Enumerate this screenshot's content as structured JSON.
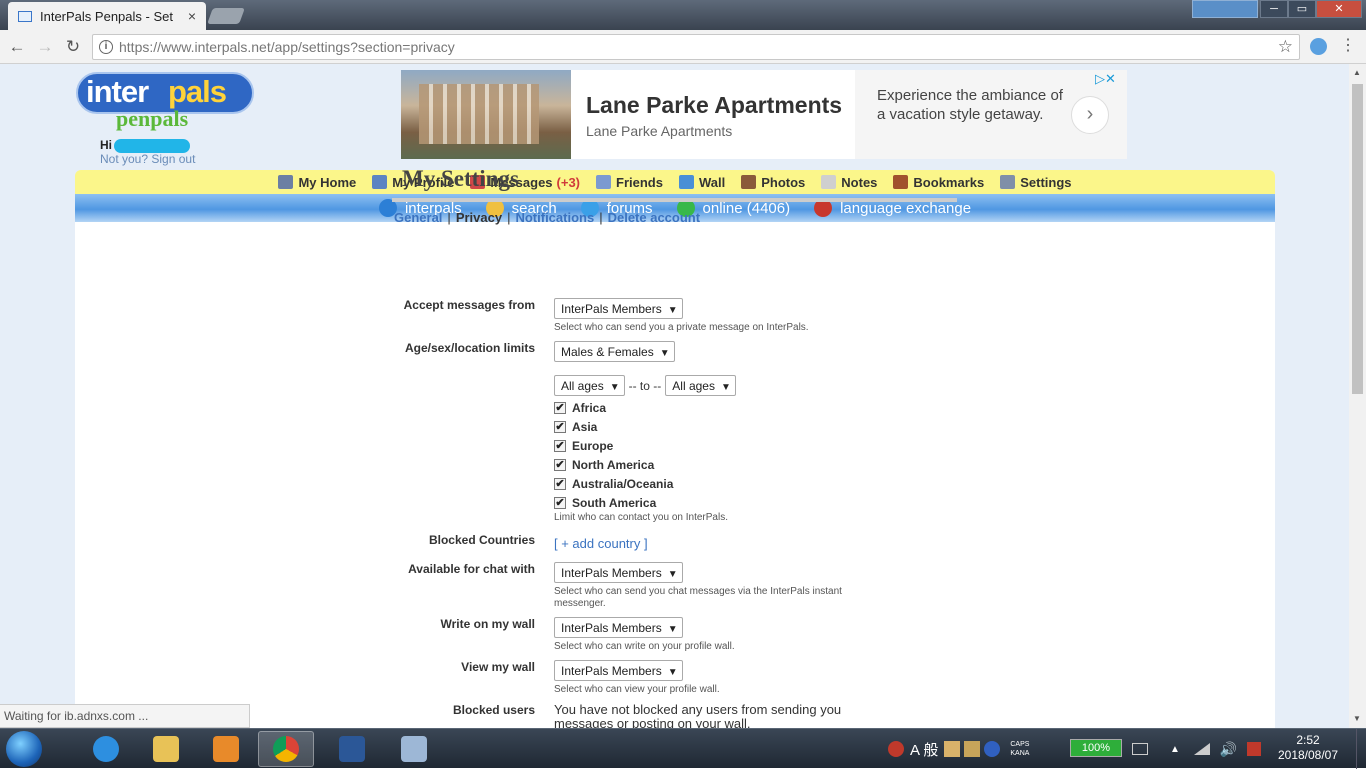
{
  "browser": {
    "tab_title": "InterPals Penpals - Set",
    "tab_close": "×",
    "url_host": "https://www.interpals.net",
    "url_path": "/app/settings?section=privacy",
    "back": "←",
    "forward": "→",
    "reload": "↻",
    "info": "i",
    "star": "☆",
    "menu": "⋮",
    "minimize": "─",
    "maximize": "▭",
    "close": "✕"
  },
  "header": {
    "logo_inter": "inter",
    "logo_pals": "pals",
    "logo_penpals": "penpals",
    "greeting": "Hi",
    "signout": "Not you? Sign out"
  },
  "ad": {
    "title": "Lane Parke Apartments",
    "subtitle": "Lane Parke Apartments",
    "copy": "Experience the ambiance of a vacation style getaway.",
    "next": "›",
    "adchoices": "▷✕"
  },
  "main_nav": [
    {
      "label": "My Home",
      "icon": "home-icon",
      "color": "#6b7fa3"
    },
    {
      "label": "My Profile",
      "icon": "profile-icon",
      "color": "#5c84c2"
    },
    {
      "label": "Messages",
      "icon": "envelope-icon",
      "color": "#d04848",
      "count": "(+3)"
    },
    {
      "label": "Friends",
      "icon": "friends-icon",
      "color": "#7b9ad0"
    },
    {
      "label": "Wall",
      "icon": "wall-icon",
      "color": "#4a8fd6"
    },
    {
      "label": "Photos",
      "icon": "photos-icon",
      "color": "#8a5a3a"
    },
    {
      "label": "Notes",
      "icon": "notes-icon",
      "color": "#cfcfcf"
    },
    {
      "label": "Bookmarks",
      "icon": "bookmark-icon",
      "color": "#a0522d"
    },
    {
      "label": "Settings",
      "icon": "settings-icon",
      "color": "#7f8fa8"
    }
  ],
  "sub_nav": [
    {
      "label": "interpals",
      "icon": "globe-icon",
      "color": "#2c7fd6"
    },
    {
      "label": "search",
      "icon": "search-icon",
      "color": "#f0c040"
    },
    {
      "label": "forums",
      "icon": "forums-icon",
      "color": "#3aa0e8"
    },
    {
      "label": "online (4406)",
      "icon": "online-icon",
      "color": "#38b84a"
    },
    {
      "label": "language exchange",
      "icon": "flag-icon",
      "color": "#c8372d"
    }
  ],
  "settings": {
    "title": "My Settings",
    "tabs": {
      "general": "General",
      "privacy": "Privacy",
      "notifications": "Notifications",
      "delete": "Delete account",
      "sep": "|"
    },
    "accept_messages": {
      "label": "Accept messages from",
      "value": "InterPals Members",
      "help": "Select who can send you a private message on InterPals."
    },
    "limits": {
      "label": "Age/sex/location limits",
      "sex_value": "Males & Females",
      "age_from": "All ages",
      "age_to": "All ages",
      "to_text": "-- to --",
      "regions": [
        "Africa",
        "Asia",
        "Europe",
        "North America",
        "Australia/Oceania",
        "South America"
      ],
      "help": "Limit who can contact you on InterPals."
    },
    "blocked_countries": {
      "label": "Blocked Countries",
      "link": "[ + add country ]"
    },
    "chat": {
      "label": "Available for chat with",
      "value": "InterPals Members",
      "help": "Select who can send you chat messages via the InterPals instant messenger."
    },
    "write_wall": {
      "label": "Write on my wall",
      "value": "InterPals Members",
      "help": "Select who can write on your profile wall."
    },
    "view_wall": {
      "label": "View my wall",
      "value": "InterPals Members",
      "help": "Select who can view your profile wall."
    },
    "blocked_users": {
      "label": "Blocked users",
      "text": "You have not blocked any users from sending you messages or posting on your wall."
    }
  },
  "status_bar": "Waiting for ib.adnxs.com ...",
  "taskbar": {
    "ime": "A 般",
    "caps": "CAPS",
    "kana": "KANA",
    "battery": "100%",
    "time": "2:52",
    "date": "2018/08/07"
  }
}
